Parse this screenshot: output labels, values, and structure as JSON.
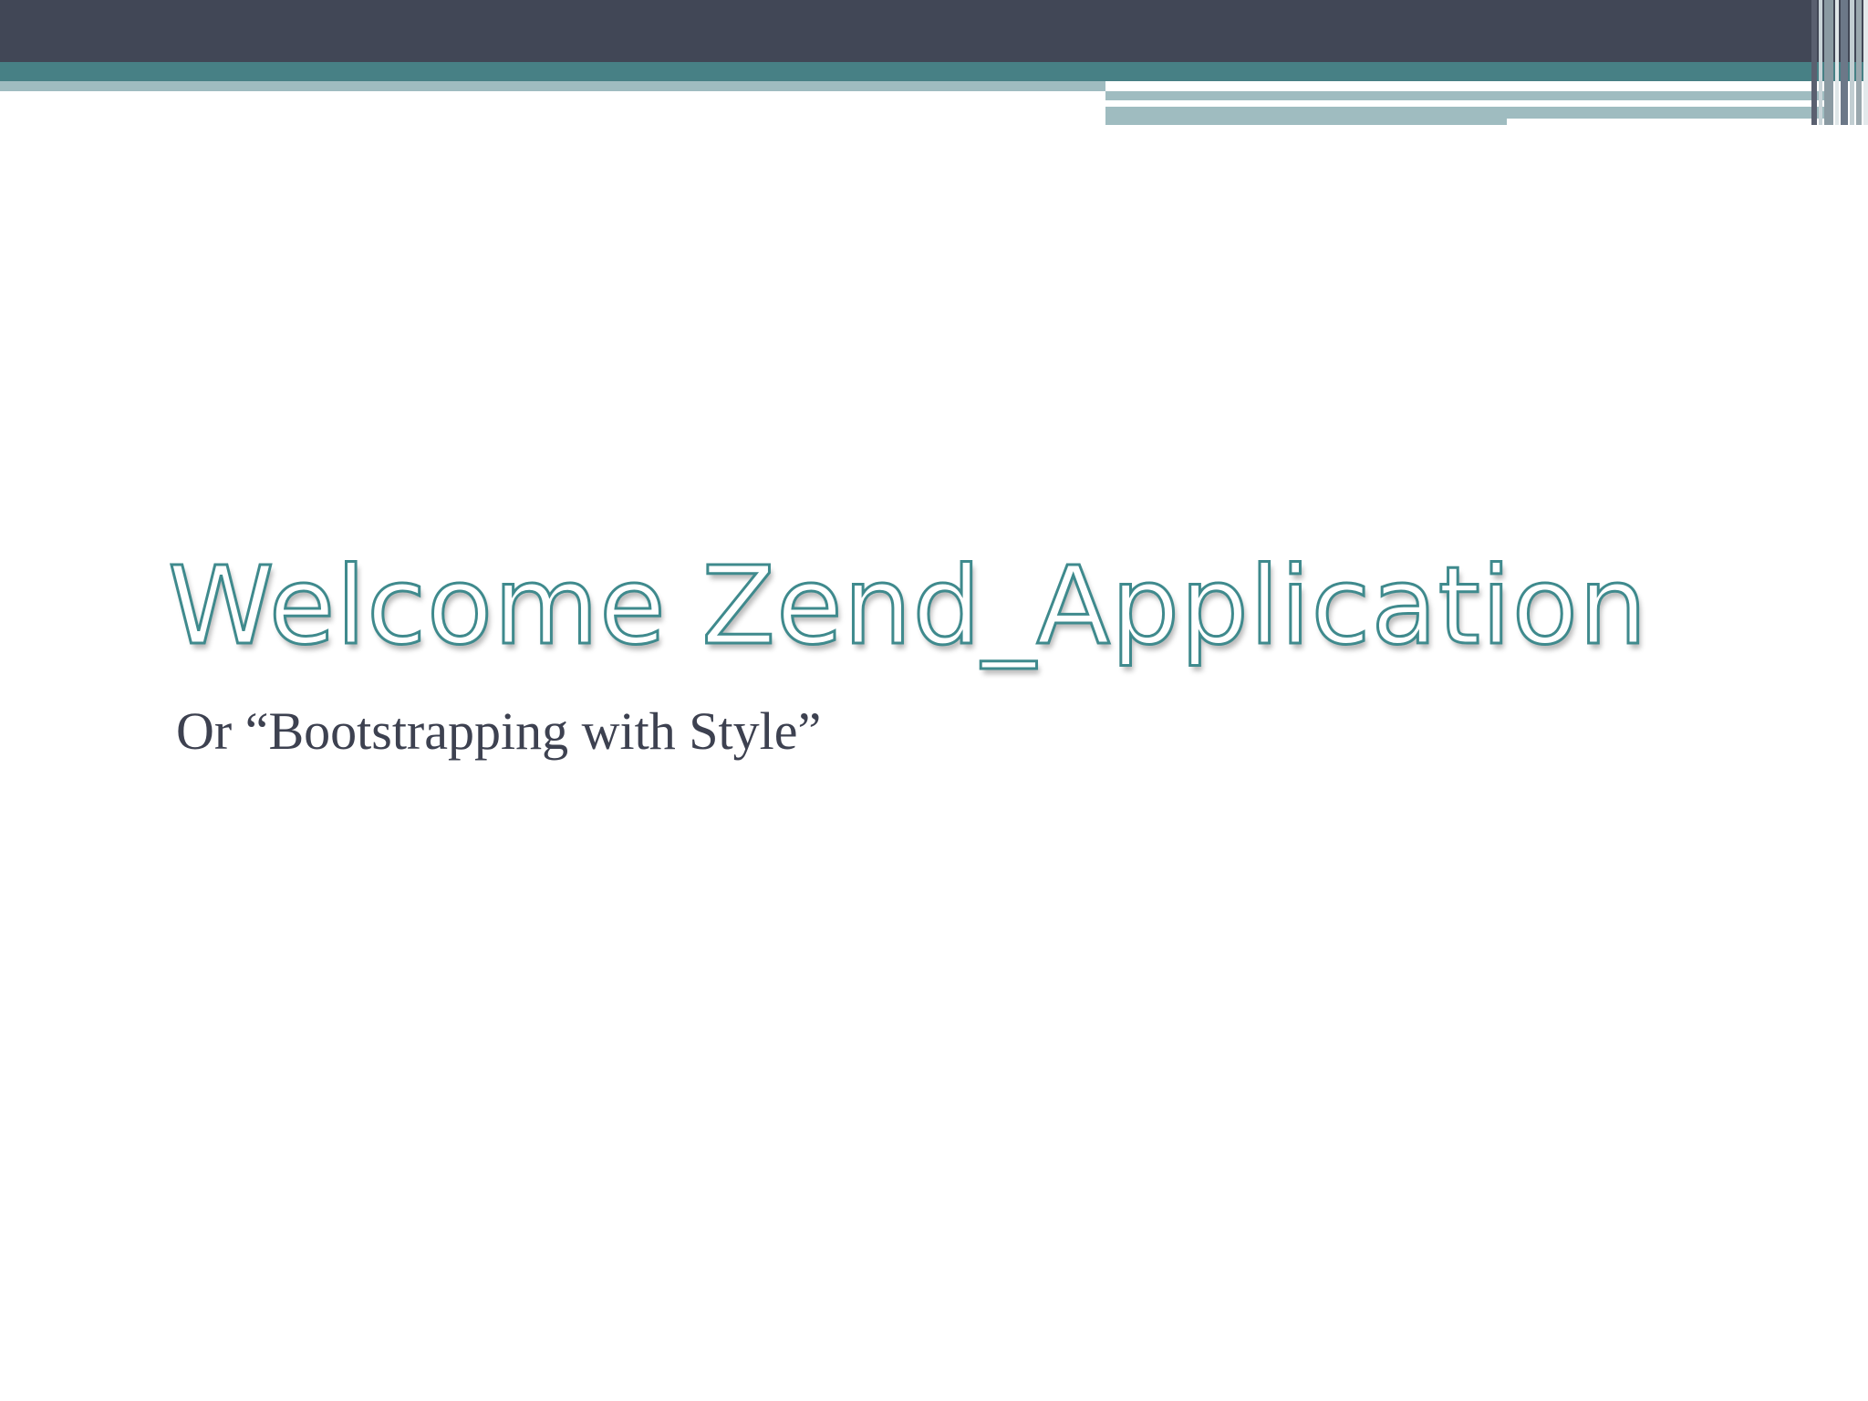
{
  "slide": {
    "title": "Welcome Zend_Application",
    "subtitle": "Or “Bootstrapping with Style”"
  },
  "colors": {
    "header_dark": "#414756",
    "header_teal": "#478085",
    "header_light": "#9fbcc0",
    "title_outline": "#3f8a8d",
    "subtitle_text": "#3d4150",
    "background": "#ffffff"
  }
}
